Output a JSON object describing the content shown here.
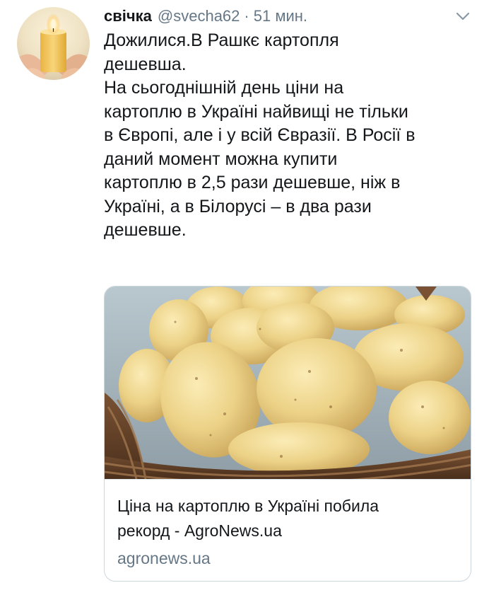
{
  "tweet": {
    "author_name": "свічка",
    "author_handle": "@svecha62",
    "separator": "·",
    "time": "51 мин.",
    "avatar_icon": "candle-avatar-icon",
    "menu_icon": "chevron-down-icon",
    "text": "Дожилися.В Рашкє картопля\nдешевша.\nНа сьогоднішній день ціни на\nкартоплю в Україні найвищі не тільки\nв Європі, але і у всій Євразії. В Росії в\nданий момент можна купити\nкартоплю в 2,5 рази дешевше, ніж в\nУкраїні, а в Білорусі – в два рази\nдешевше."
  },
  "link_card": {
    "image_icon": "potato-basket-image",
    "title_line1": "Ціна на картоплю в Україні побила",
    "title_line2": "рекорд - AgroNews.ua",
    "domain": "agronews.ua"
  },
  "colors": {
    "text": "#14171a",
    "secondary": "#657786",
    "border": "#ccd6dd"
  }
}
